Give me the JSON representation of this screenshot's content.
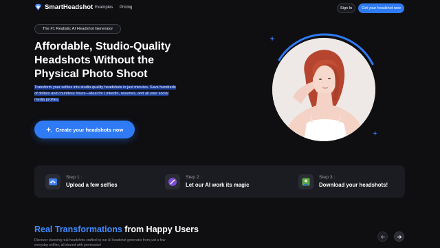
{
  "nav": {
    "brand": "SmartHeadshot",
    "links": [
      "Examples",
      "Pricing"
    ],
    "signin_label": "Sign In",
    "cta_label": "Get your headshot now"
  },
  "hero": {
    "badge": "The #1 Realistic AI Headshot Generator",
    "title": "Affordable, Studio-Quality Headshots Without the Physical Photo Shoot",
    "description": "Transform your selfies into studio-quality headshots in just minutes. Save hundreds of dollars and countless hours—ideal for LinkedIn, resumes, and all your social media profiles.",
    "cta_label": "Create your headshots now",
    "cta_icon": "sparkles-icon",
    "image_alt": "portrait-photo"
  },
  "steps": [
    {
      "num": "Step 1 :",
      "label": "Upload a few selfies",
      "icon": "cloud-upload-icon"
    },
    {
      "num": "Step 2 :",
      "label": "Let our AI work its magic",
      "icon": "magic-wand-icon"
    },
    {
      "num": "Step 3 :",
      "label": "Download your headshots!",
      "icon": "image-download-icon"
    }
  ],
  "transformations": {
    "title_accent": "Real Transformations",
    "title_rest": " from Happy Users",
    "description": "Discover stunning real headshots crafted by our AI headshot generator from just a few everyday selfies, all shared with permission!"
  },
  "colors": {
    "background": "#0f0f12",
    "accent": "#2f7bf5",
    "highlight": "#1d3f9a",
    "card": "#1b1c21"
  }
}
